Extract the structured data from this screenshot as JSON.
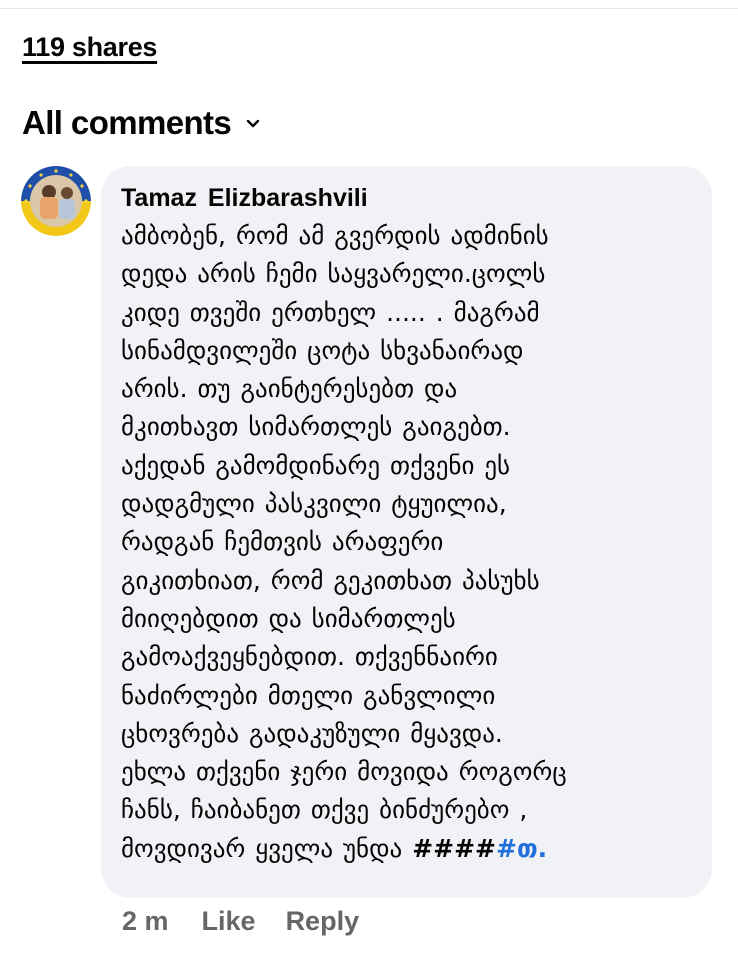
{
  "shares": {
    "label": "119 shares"
  },
  "comments_filter": {
    "label": "All comments",
    "icon": "chevron-down-icon"
  },
  "comment": {
    "author": "Tamaz  Elizbarashvili",
    "lines": [
      "ამბობენ, რომ ამ გვერდის ადმინის",
      "დედა არის ჩემი საყვარელი.ცოლს",
      "კიდე თვეში ერთხელ ..... . მაგრამ",
      "სინამდვილეში ცოტა სხვანაირად",
      "არის. თუ გაინტერესებთ და",
      "მკითხავთ სიმართლეს გაიგებთ.",
      "აქედან გამომდინარე თქვენი ეს",
      "დადგმული პასკვილი ტყუილია,",
      "რადგან ჩემთვის არაფერი",
      "გიკითხიათ, რომ გეკითხათ პასუხს",
      "მიიღებდით და სიმართლეს",
      "გამოაქვეყნებდით. თქვენნაირი",
      "ნაძირლები მთელი განვლილი",
      "ცხოვრება გადაკუზული მყავდა.",
      "ეხლა თქვენი ჯერი მოვიდა როგორც",
      "ჩანს, ჩაიბანეთ თქვე ბინძურებო ,"
    ],
    "last_line_prefix": "მოვდივარ ყველა უნდა ",
    "last_line_hashes": "####",
    "last_line_link": "#თ.",
    "time": "2 m",
    "like_label": "Like",
    "reply_label": "Reply"
  },
  "colors": {
    "link": "#216fdb",
    "meta": "#65676b",
    "bubble": "#f0f2f5"
  }
}
